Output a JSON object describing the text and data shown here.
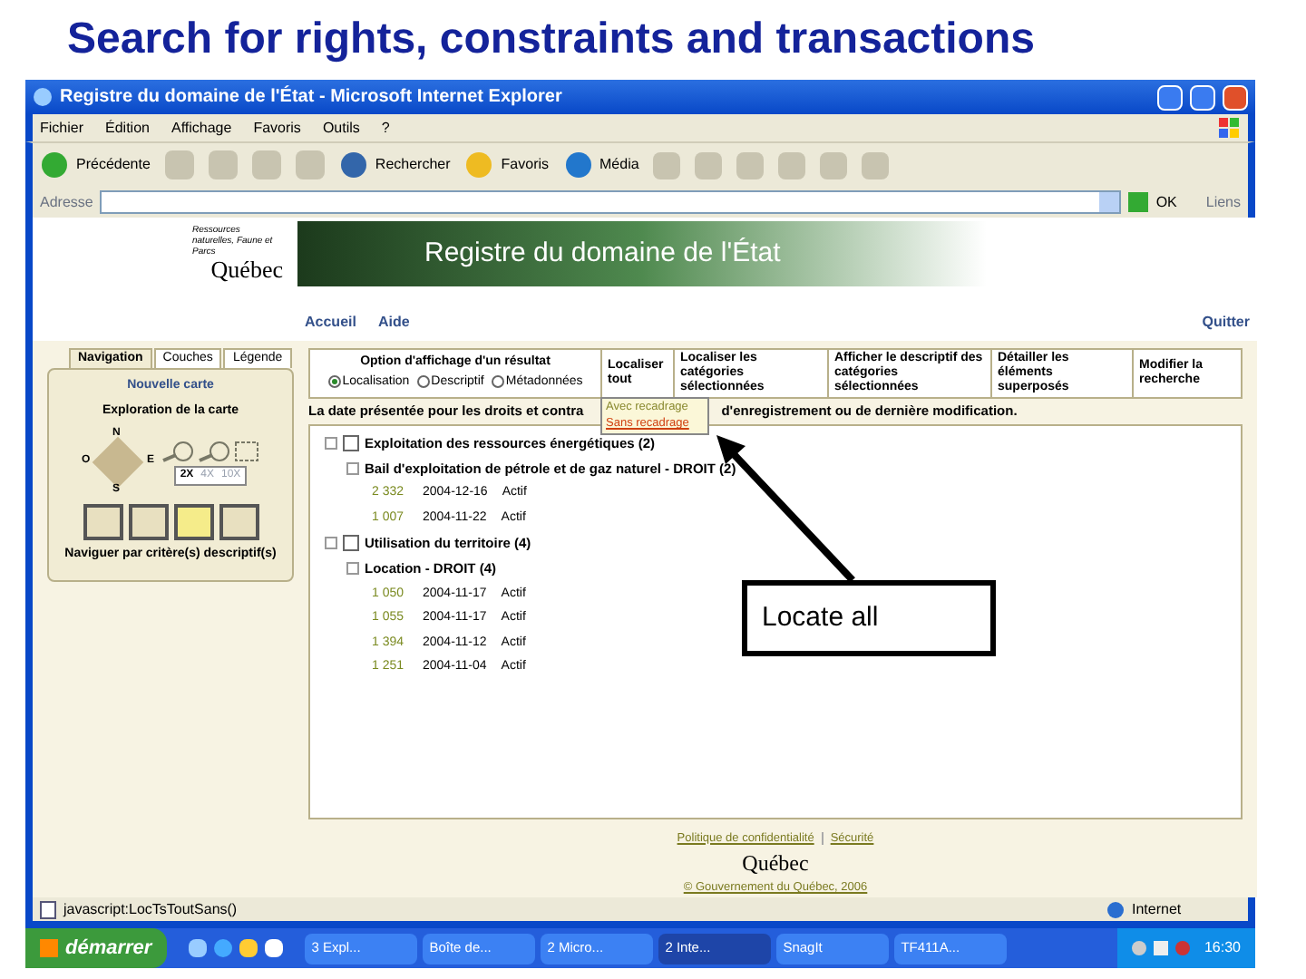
{
  "slide_title": "Search for rights, constraints and transactions",
  "window": {
    "title": "Registre du domaine de l'État - Microsoft Internet Explorer"
  },
  "menu": [
    "Fichier",
    "Édition",
    "Affichage",
    "Favoris",
    "Outils",
    "?"
  ],
  "toolbar": [
    "Précédente",
    "Rechercher",
    "Favoris",
    "Média"
  ],
  "address": {
    "label": "Adresse",
    "go": "OK",
    "links": "Liens"
  },
  "header": {
    "ministry": "Ressources naturelles, Faune et Parcs",
    "logo": "Québec",
    "banner": "Registre du domaine de l'État"
  },
  "top_links": [
    "Accueil",
    "Aide"
  ],
  "quit": "Quitter",
  "left_panel": {
    "tabs": [
      {
        "label": "Navigation",
        "selected": true
      },
      {
        "label": "Couches",
        "selected": false
      },
      {
        "label": "Légende",
        "selected": false
      }
    ],
    "new_map": "Nouvelle carte",
    "exploration": "Exploration de la carte",
    "compass": [
      "N",
      "O",
      "E",
      "S"
    ],
    "zoom_levels": [
      {
        "label": "2X",
        "selected": true
      },
      {
        "label": "4X",
        "selected": false
      },
      {
        "label": "10X",
        "selected": false
      }
    ],
    "browse": "Naviguer par critère(s) descriptif(s)"
  },
  "options": {
    "title": "Option d'affichage d'un résultat",
    "radios": [
      {
        "label": "Localisation",
        "selected": true
      },
      {
        "label": "Descriptif",
        "selected": false
      },
      {
        "label": "Métadonnées",
        "selected": false
      }
    ],
    "actions": [
      "Localiser tout",
      "Localiser les catégories sélectionnées",
      "Afficher le descriptif des catégories sélectionnées",
      "Détailler les éléments superposés",
      "Modifier la recherche"
    ],
    "dropdown": [
      {
        "label": "Avec recadrage",
        "selected": false
      },
      {
        "label": "Sans recadrage",
        "selected": true
      }
    ]
  },
  "note": [
    "La date présentée pour les droits et contra",
    "d'enregistrement ou de dernière modification."
  ],
  "tree": [
    {
      "label": "Exploitation des ressources énergétiques (2)",
      "checked": false,
      "children": [
        {
          "label": "Bail d'exploitation de pétrole et de gaz naturel - DROIT (2)",
          "rows": [
            {
              "number": "2 332",
              "date": "2004-12-16",
              "status": "Actif"
            },
            {
              "number": "1 007",
              "date": "2004-11-22",
              "status": "Actif"
            }
          ]
        }
      ]
    },
    {
      "label": "Utilisation du territoire (4)",
      "checked": false,
      "children": [
        {
          "label": "Location - DROIT (4)",
          "rows": [
            {
              "number": "1 050",
              "date": "2004-11-17",
              "status": "Actif"
            },
            {
              "number": "1 055",
              "date": "2004-11-17",
              "status": "Actif"
            },
            {
              "number": "1 394",
              "date": "2004-11-12",
              "status": "Actif"
            },
            {
              "number": "1 251",
              "date": "2004-11-04",
              "status": "Actif"
            }
          ]
        }
      ]
    }
  ],
  "footer": {
    "links": [
      "Politique de confidentialité",
      "Sécurité"
    ],
    "logo": "Québec",
    "copyright": "© Gouvernement du Québec, 2006"
  },
  "status_bar": {
    "text": "javascript:LocTsToutSans()",
    "zone": "Internet"
  },
  "taskbar": {
    "start": "démarrer",
    "tasks": [
      {
        "label": "3 Expl...",
        "selected": false
      },
      {
        "label": "Boîte de...",
        "selected": false
      },
      {
        "label": "2 Micro...",
        "selected": false
      },
      {
        "label": "2 Inte...",
        "selected": true
      },
      {
        "label": "SnagIt",
        "selected": false
      },
      {
        "label": "TF411A...",
        "selected": false
      }
    ],
    "clock": "16:30"
  },
  "callout": "Locate all"
}
